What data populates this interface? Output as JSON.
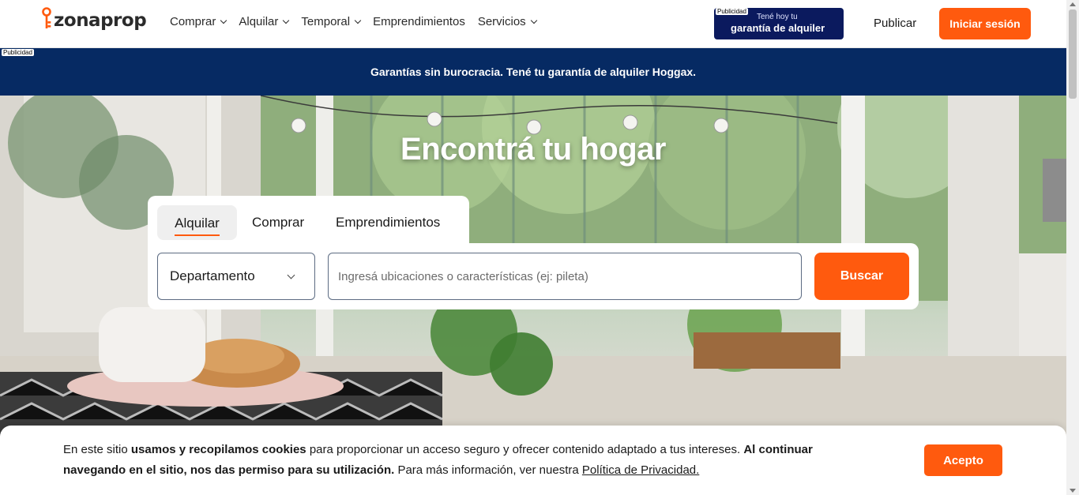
{
  "header": {
    "logo_text": "zonaprop",
    "nav": [
      {
        "label": "Comprar",
        "dropdown": true
      },
      {
        "label": "Alquilar",
        "dropdown": true
      },
      {
        "label": "Temporal",
        "dropdown": true
      },
      {
        "label": "Emprendimientos",
        "dropdown": false
      },
      {
        "label": "Servicios",
        "dropdown": true
      }
    ],
    "ad": {
      "tag": "Publicidad",
      "line1": "Tené hoy tu",
      "line2": "garantía de alquiler"
    },
    "publicar_label": "Publicar",
    "login_label": "Iniciar sesión"
  },
  "banner": {
    "ad_tag": "Publicidad",
    "text": "Garantías sin burocracia.  Tené tu garantía de alquiler Hoggax."
  },
  "hero": {
    "title": "Encontrá tu hogar"
  },
  "search": {
    "tabs": [
      {
        "label": "Alquilar",
        "active": true
      },
      {
        "label": "Comprar",
        "active": false
      },
      {
        "label": "Emprendimientos",
        "active": false
      }
    ],
    "property_type": "Departamento",
    "input_placeholder": "Ingresá ubicaciones o características (ej: pileta)",
    "button_label": "Buscar"
  },
  "cookie": {
    "part1": "En este sitio ",
    "bold1": "usamos y recopilamos cookies",
    "part2": " para proporcionar un acceso seguro y ofrecer contenido adaptado a tus intereses. ",
    "bold2": "Al continuar navegando en el sitio, nos das permiso para su utilización.",
    "part3": " Para más información, ver nuestra ",
    "link": "Política de Privacidad.",
    "accept_label": "Acepto"
  },
  "colors": {
    "brand_orange": "#ff5a0e",
    "banner_navy": "#062a63",
    "ad_navy": "#0b1a5e"
  }
}
